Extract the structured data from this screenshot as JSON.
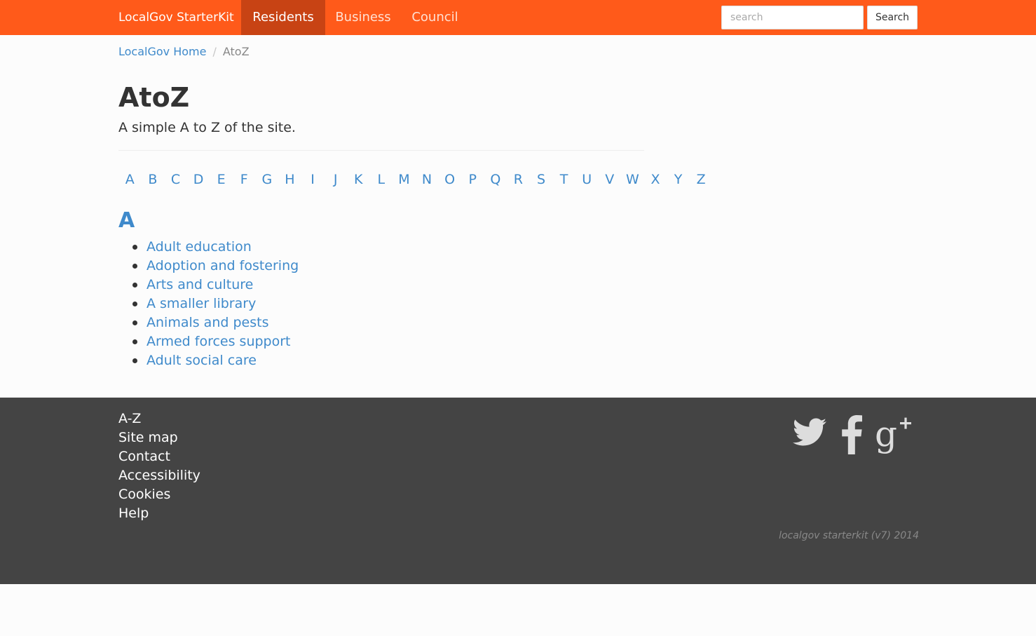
{
  "navbar": {
    "brand": "LocalGov StarterKit",
    "items": [
      {
        "label": "Residents"
      },
      {
        "label": "Business"
      },
      {
        "label": "Council"
      }
    ],
    "search": {
      "placeholder": "search",
      "value": "",
      "button_label": "Search"
    }
  },
  "breadcrumb": {
    "home": "LocalGov Home",
    "separator": "/",
    "current": "AtoZ"
  },
  "page": {
    "title": "AtoZ",
    "intro": "A simple A to Z of the site."
  },
  "letters": [
    "A",
    "B",
    "C",
    "D",
    "E",
    "F",
    "G",
    "H",
    "I",
    "J",
    "K",
    "L",
    "M",
    "N",
    "O",
    "P",
    "Q",
    "R",
    "S",
    "T",
    "U",
    "V",
    "W",
    "X",
    "Y",
    "Z"
  ],
  "section": {
    "letter": "A",
    "items": [
      "Adult education",
      "Adoption and fostering",
      "Arts and culture",
      "A smaller library",
      "Animals and pests",
      "Armed forces support",
      "Adult social care"
    ]
  },
  "footer": {
    "links": [
      "A-Z",
      "Site map",
      "Contact",
      "Accessibility",
      "Cookies",
      "Help"
    ],
    "social_icons": [
      "twitter-icon",
      "facebook-icon",
      "google-plus-icon"
    ],
    "copyright": "localgov starterkit (v7) 2014"
  },
  "colors": {
    "brand_orange": "#ff5a1a",
    "active_tab": "#c84314",
    "link_blue": "#3f8acb",
    "footer_bg": "#444444"
  }
}
